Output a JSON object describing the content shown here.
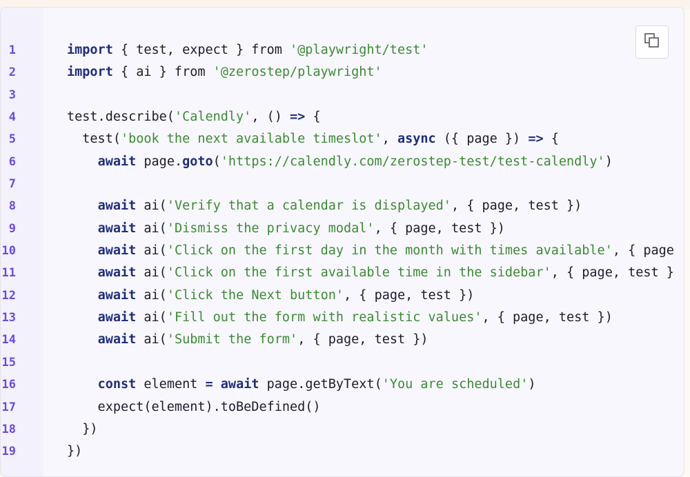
{
  "copy_button": {
    "icon": "copy-icon",
    "label": ""
  },
  "lines": [
    {
      "n": "1",
      "tokens": [
        {
          "t": "import",
          "c": "kw"
        },
        {
          "t": " { test, expect } from ",
          "c": ""
        },
        {
          "t": "'@playwright/test'",
          "c": "str"
        }
      ]
    },
    {
      "n": "2",
      "tokens": [
        {
          "t": "import",
          "c": "kw"
        },
        {
          "t": " { ai } from ",
          "c": ""
        },
        {
          "t": "'@zerostep/playwright'",
          "c": "str"
        }
      ]
    },
    {
      "n": "3",
      "tokens": []
    },
    {
      "n": "4",
      "tokens": [
        {
          "t": "test.describe(",
          "c": ""
        },
        {
          "t": "'Calendly'",
          "c": "str"
        },
        {
          "t": ", () ",
          "c": ""
        },
        {
          "t": "=>",
          "c": "op"
        },
        {
          "t": " {",
          "c": ""
        }
      ]
    },
    {
      "n": "5",
      "tokens": [
        {
          "t": "  test(",
          "c": ""
        },
        {
          "t": "'book the next available timeslot'",
          "c": "str"
        },
        {
          "t": ", ",
          "c": ""
        },
        {
          "t": "async",
          "c": "kw"
        },
        {
          "t": " ({ page }) ",
          "c": ""
        },
        {
          "t": "=>",
          "c": "op"
        },
        {
          "t": " {",
          "c": ""
        }
      ]
    },
    {
      "n": "6",
      "tokens": [
        {
          "t": "    ",
          "c": ""
        },
        {
          "t": "await",
          "c": "kw"
        },
        {
          "t": " page.",
          "c": ""
        },
        {
          "t": "goto",
          "c": "kw"
        },
        {
          "t": "(",
          "c": ""
        },
        {
          "t": "'https://calendly.com/zerostep-test/test-calendly'",
          "c": "str"
        },
        {
          "t": ")",
          "c": ""
        }
      ]
    },
    {
      "n": "7",
      "tokens": []
    },
    {
      "n": "8",
      "tokens": [
        {
          "t": "    ",
          "c": ""
        },
        {
          "t": "await",
          "c": "kw"
        },
        {
          "t": " ai(",
          "c": ""
        },
        {
          "t": "'Verify that a calendar is displayed'",
          "c": "str"
        },
        {
          "t": ", { page, test })",
          "c": ""
        }
      ]
    },
    {
      "n": "9",
      "tokens": [
        {
          "t": "    ",
          "c": ""
        },
        {
          "t": "await",
          "c": "kw"
        },
        {
          "t": " ai(",
          "c": ""
        },
        {
          "t": "'Dismiss the privacy modal'",
          "c": "str"
        },
        {
          "t": ", { page, test })",
          "c": ""
        }
      ]
    },
    {
      "n": "10",
      "tokens": [
        {
          "t": "    ",
          "c": ""
        },
        {
          "t": "await",
          "c": "kw"
        },
        {
          "t": " ai(",
          "c": ""
        },
        {
          "t": "'Click on the first day in the month with times available'",
          "c": "str"
        },
        {
          "t": ", { page",
          "c": ""
        }
      ]
    },
    {
      "n": "11",
      "tokens": [
        {
          "t": "    ",
          "c": ""
        },
        {
          "t": "await",
          "c": "kw"
        },
        {
          "t": " ai(",
          "c": ""
        },
        {
          "t": "'Click on the first available time in the sidebar'",
          "c": "str"
        },
        {
          "t": ", { page, test }",
          "c": ""
        }
      ]
    },
    {
      "n": "12",
      "tokens": [
        {
          "t": "    ",
          "c": ""
        },
        {
          "t": "await",
          "c": "kw"
        },
        {
          "t": " ai(",
          "c": ""
        },
        {
          "t": "'Click the Next button'",
          "c": "str"
        },
        {
          "t": ", { page, test })",
          "c": ""
        }
      ]
    },
    {
      "n": "13",
      "tokens": [
        {
          "t": "    ",
          "c": ""
        },
        {
          "t": "await",
          "c": "kw"
        },
        {
          "t": " ai(",
          "c": ""
        },
        {
          "t": "'Fill out the form with realistic values'",
          "c": "str"
        },
        {
          "t": ", { page, test })",
          "c": ""
        }
      ]
    },
    {
      "n": "14",
      "tokens": [
        {
          "t": "    ",
          "c": ""
        },
        {
          "t": "await",
          "c": "kw"
        },
        {
          "t": " ai(",
          "c": ""
        },
        {
          "t": "'Submit the form'",
          "c": "str"
        },
        {
          "t": ", { page, test })",
          "c": ""
        }
      ]
    },
    {
      "n": "15",
      "tokens": []
    },
    {
      "n": "16",
      "tokens": [
        {
          "t": "    ",
          "c": ""
        },
        {
          "t": "const",
          "c": "kw"
        },
        {
          "t": " element ",
          "c": ""
        },
        {
          "t": "=",
          "c": "op"
        },
        {
          "t": " ",
          "c": ""
        },
        {
          "t": "await",
          "c": "kw"
        },
        {
          "t": " page.getByText(",
          "c": ""
        },
        {
          "t": "'You are scheduled'",
          "c": "str"
        },
        {
          "t": ")",
          "c": ""
        }
      ]
    },
    {
      "n": "17",
      "tokens": [
        {
          "t": "    expect(element).toBeDefined()",
          "c": ""
        }
      ]
    },
    {
      "n": "18",
      "tokens": [
        {
          "t": "  })",
          "c": ""
        }
      ]
    },
    {
      "n": "19",
      "tokens": [
        {
          "t": "})",
          "c": ""
        }
      ]
    }
  ]
}
